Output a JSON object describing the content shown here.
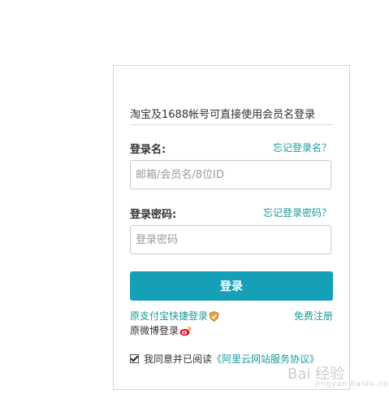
{
  "login": {
    "heading": "淘宝及1688帐号可直接使用会员名登录",
    "username_label": "登录名:",
    "forgot_username": "忘记登录名？",
    "username_placeholder": "邮箱/会员名/8位ID",
    "username_value": "",
    "password_label": "登录密码:",
    "forgot_password": "忘记登录密码？",
    "password_placeholder": "登录密码",
    "password_value": "",
    "submit_label": "登录",
    "alipay_login": "原支付宝快捷登录",
    "register": "免费注册",
    "weibo_login": "原微博登录",
    "agree_text": "我同意并已阅读",
    "agreement_link": "《阿里云网站服务协议》",
    "agreed": true
  },
  "watermark": {
    "brand": "Bai 经验",
    "url": "jingyan.baidu.com"
  },
  "colors": {
    "accent": "#15a0b8",
    "link": "#1a9a9a",
    "border": "#d6d6d6"
  },
  "icons": {
    "alipay": "alipay-shield-icon",
    "weibo": "weibo-icon",
    "checkbox": "checkbox-checked"
  }
}
